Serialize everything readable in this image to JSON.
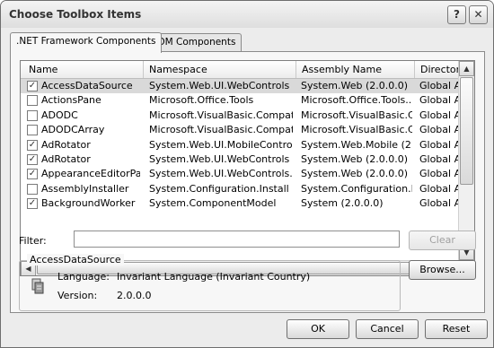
{
  "window": {
    "title": "Choose Toolbox Items",
    "help_glyph": "?",
    "close_glyph": "✕"
  },
  "tabs": [
    {
      "label": ".NET Framework Components",
      "active": true
    },
    {
      "label": "COM Components",
      "active": false
    }
  ],
  "list": {
    "columns": [
      "Name",
      "Namespace",
      "Assembly Name",
      "Directory"
    ],
    "rows": [
      {
        "checked": true,
        "selected": true,
        "name": "AccessDataSource",
        "namespace": "System.Web.UI.WebControls",
        "assembly": "System.Web (2.0.0.0)",
        "directory": "Global Ass"
      },
      {
        "checked": false,
        "selected": false,
        "name": "ActionsPane",
        "namespace": "Microsoft.Office.Tools",
        "assembly": "Microsoft.Office.Tools....",
        "directory": "Global Ass"
      },
      {
        "checked": false,
        "selected": false,
        "name": "ADODC",
        "namespace": "Microsoft.VisualBasic.Compatibi...",
        "assembly": "Microsoft.VisualBasic.C...",
        "directory": "Global Ass"
      },
      {
        "checked": false,
        "selected": false,
        "name": "ADODCArray",
        "namespace": "Microsoft.VisualBasic.Compatibi...",
        "assembly": "Microsoft.VisualBasic.C...",
        "directory": "Global Ass"
      },
      {
        "checked": true,
        "selected": false,
        "name": "AdRotator",
        "namespace": "System.Web.UI.MobileControls",
        "assembly": "System.Web.Mobile (2....",
        "directory": "Global Ass"
      },
      {
        "checked": true,
        "selected": false,
        "name": "AdRotator",
        "namespace": "System.Web.UI.WebControls",
        "assembly": "System.Web (2.0.0.0)",
        "directory": "Global Ass"
      },
      {
        "checked": true,
        "selected": false,
        "name": "AppearanceEditorPart",
        "namespace": "System.Web.UI.WebControls....",
        "assembly": "System.Web (2.0.0.0)",
        "directory": "Global Ass"
      },
      {
        "checked": false,
        "selected": false,
        "name": "AssemblyInstaller",
        "namespace": "System.Configuration.Install",
        "assembly": "System.Configuration.I...",
        "directory": "Global Ass"
      },
      {
        "checked": true,
        "selected": false,
        "name": "BackgroundWorker",
        "namespace": "System.ComponentModel",
        "assembly": "System (2.0.0.0)",
        "directory": "Global Ass"
      }
    ],
    "check_glyph": "✓"
  },
  "filter": {
    "label": "Filter:",
    "value": "",
    "clear_label": "Clear"
  },
  "details": {
    "group_title": "AccessDataSource",
    "language_label": "Language:",
    "language_value": "Invariant Language (Invariant Country)",
    "version_label": "Version:",
    "version_value": "2.0.0.0",
    "icon": "component-icon"
  },
  "buttons": {
    "browse": "Browse...",
    "ok": "OK",
    "cancel": "Cancel",
    "reset": "Reset"
  }
}
